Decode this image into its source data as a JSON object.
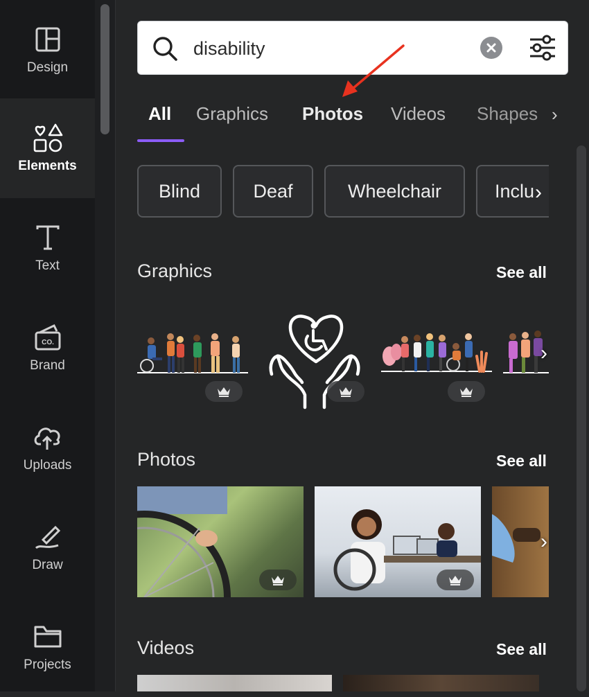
{
  "sidebar": {
    "items": [
      {
        "label": "Design",
        "icon": "layout-icon"
      },
      {
        "label": "Elements",
        "icon": "shapes-icon"
      },
      {
        "label": "Text",
        "icon": "text-icon"
      },
      {
        "label": "Brand",
        "icon": "brand-kit-icon"
      },
      {
        "label": "Uploads",
        "icon": "cloud-upload-icon"
      },
      {
        "label": "Draw",
        "icon": "pen-icon"
      },
      {
        "label": "Projects",
        "icon": "folder-icon"
      }
    ],
    "active": "Elements"
  },
  "search": {
    "value": "disability",
    "placeholder": ""
  },
  "tabs": [
    {
      "label": "All"
    },
    {
      "label": "Graphics"
    },
    {
      "label": "Photos"
    },
    {
      "label": "Videos"
    },
    {
      "label": "Shapes"
    }
  ],
  "selected_tab": "All",
  "chips": [
    {
      "label": "Blind"
    },
    {
      "label": "Deaf"
    },
    {
      "label": "Wheelchair"
    },
    {
      "label": "Inclu"
    }
  ],
  "sections": {
    "graphics": {
      "title": "Graphics",
      "see_all": "See all"
    },
    "photos": {
      "title": "Photos",
      "see_all": "See all"
    },
    "videos": {
      "title": "Videos",
      "see_all": "See all"
    }
  },
  "colors": {
    "accent": "#8b5cf6",
    "annotation_arrow": "#e8321f",
    "panel_bg": "#252627",
    "sidebar_bg": "#18191b"
  }
}
